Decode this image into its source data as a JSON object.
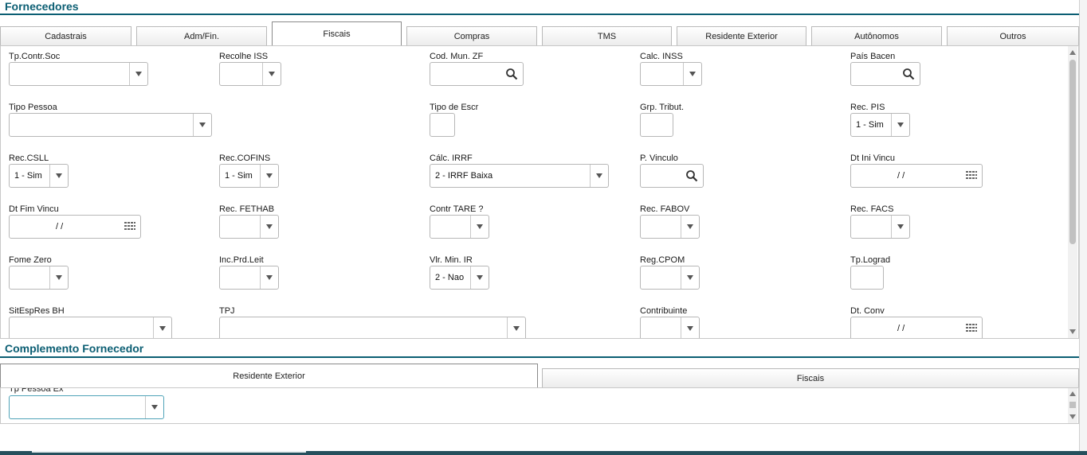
{
  "header": {
    "title": "Fornecedores"
  },
  "tabs": [
    {
      "label": "Cadastrais"
    },
    {
      "label": "Adm/Fin."
    },
    {
      "label": "Fiscais"
    },
    {
      "label": "Compras"
    },
    {
      "label": "TMS"
    },
    {
      "label": "Residente Exterior"
    },
    {
      "label": "Autônomos"
    },
    {
      "label": "Outros"
    }
  ],
  "fields": [
    {
      "label": "Tp.Contr.Soc",
      "value": ""
    },
    {
      "label": "Recolhe ISS",
      "value": ""
    },
    {
      "label": "Cod. Mun. ZF",
      "value": ""
    },
    {
      "label": "Calc. INSS",
      "value": ""
    },
    {
      "label": "País Bacen",
      "value": ""
    },
    {
      "label": "Tipo Pessoa",
      "value": ""
    },
    {
      "label": "Tipo de Escr",
      "value": ""
    },
    {
      "label": "Grp. Tribut.",
      "value": ""
    },
    {
      "label": "Rec. PIS",
      "value": "1 - Sim"
    },
    {
      "label": "Rec.CSLL",
      "value": "1 - Sim"
    },
    {
      "label": "Rec.COFINS",
      "value": "1 - Sim"
    },
    {
      "label": "Cálc. IRRF",
      "value": "2 - IRRF Baixa"
    },
    {
      "label": "P. Vinculo",
      "value": ""
    },
    {
      "label": "Dt Ini Vincu",
      "value": "/ /"
    },
    {
      "label": "Dt Fim Vincu",
      "value": "/ /"
    },
    {
      "label": "Rec. FETHAB",
      "value": ""
    },
    {
      "label": "Contr TARE ?",
      "value": ""
    },
    {
      "label": "Rec. FABOV",
      "value": ""
    },
    {
      "label": "Rec. FACS",
      "value": ""
    },
    {
      "label": "Fome Zero",
      "value": ""
    },
    {
      "label": "Inc.Prd.Leit",
      "value": ""
    },
    {
      "label": "Vlr. Min. IR",
      "value": "2 - Nao"
    },
    {
      "label": "Reg.CPOM",
      "value": ""
    },
    {
      "label": "Tp.Lograd",
      "value": ""
    },
    {
      "label": "SitEspRes BH",
      "value": ""
    },
    {
      "label": "TPJ",
      "value": ""
    },
    {
      "label": "Contribuinte",
      "value": ""
    },
    {
      "label": "Dt. Conv",
      "value": "/ /"
    }
  ],
  "complement": {
    "title": "Complemento Fornecedor",
    "tabs": [
      {
        "label": "Residente Exterior"
      },
      {
        "label": "Fiscais"
      }
    ],
    "field": {
      "label": "Tp Pessoa Ex",
      "value": ""
    }
  },
  "icons": {
    "search": "magnifier-icon",
    "calendar": "calendar-icon",
    "dropdown": "chevron-down-icon"
  },
  "colors": {
    "accent": "#0b5e73",
    "border": "#b7b7b7",
    "bottom_bar": "#25505d"
  }
}
